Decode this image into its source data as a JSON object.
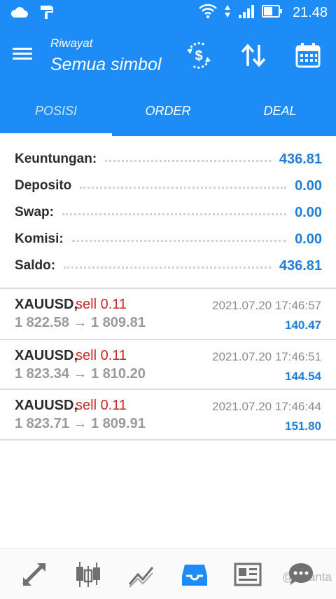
{
  "status_bar": {
    "time": "21.48",
    "icons": [
      "cloud-icon",
      "paint-roller-icon",
      "wifi-icon",
      "data-arrows-icon",
      "signal-icon",
      "battery-icon"
    ]
  },
  "header": {
    "subtitle": "Riwayat",
    "title": "Semua simbol",
    "actions": [
      "deposit-withdraw-icon",
      "sort-icon",
      "calendar-icon"
    ],
    "color": "#1e8cf6"
  },
  "tabs": [
    {
      "label": "POSISI",
      "active": true
    },
    {
      "label": "ORDER",
      "active": false
    },
    {
      "label": "DEAL",
      "active": false
    }
  ],
  "summary": [
    {
      "label": "Keuntungan:",
      "value": "436.81"
    },
    {
      "label": "Deposito",
      "value": "0.00"
    },
    {
      "label": "Swap:",
      "value": "0.00"
    },
    {
      "label": "Komisi:",
      "value": "0.00"
    },
    {
      "label": "Saldo:",
      "value": "436.81"
    }
  ],
  "deals": [
    {
      "symbol": "XAUUSD,",
      "type": "sell 0.11",
      "time": "2021.07.20 17:46:57",
      "prices": "1 822.58 → 1 809.81",
      "profit": "140.47"
    },
    {
      "symbol": "XAUUSD,",
      "type": "sell 0.11",
      "time": "2021.07.20 17:46:51",
      "prices": "1 823.34 → 1 810.20",
      "profit": "144.54"
    },
    {
      "symbol": "XAUUSD,",
      "type": "sell 0.11",
      "time": "2021.07.20 17:46:44",
      "prices": "1 823.71 → 1 809.91",
      "profit": "151.80"
    }
  ],
  "bottom_nav": [
    "trade-arrows-icon",
    "candlestick-icon",
    "chart-icon",
    "history-inbox-icon",
    "news-icon",
    "chat-icon"
  ],
  "watermark": "@Ananta",
  "colors": {
    "accent": "#1e8cf6",
    "value_blue": "#1f7ed6",
    "sell_red": "#c62828"
  }
}
